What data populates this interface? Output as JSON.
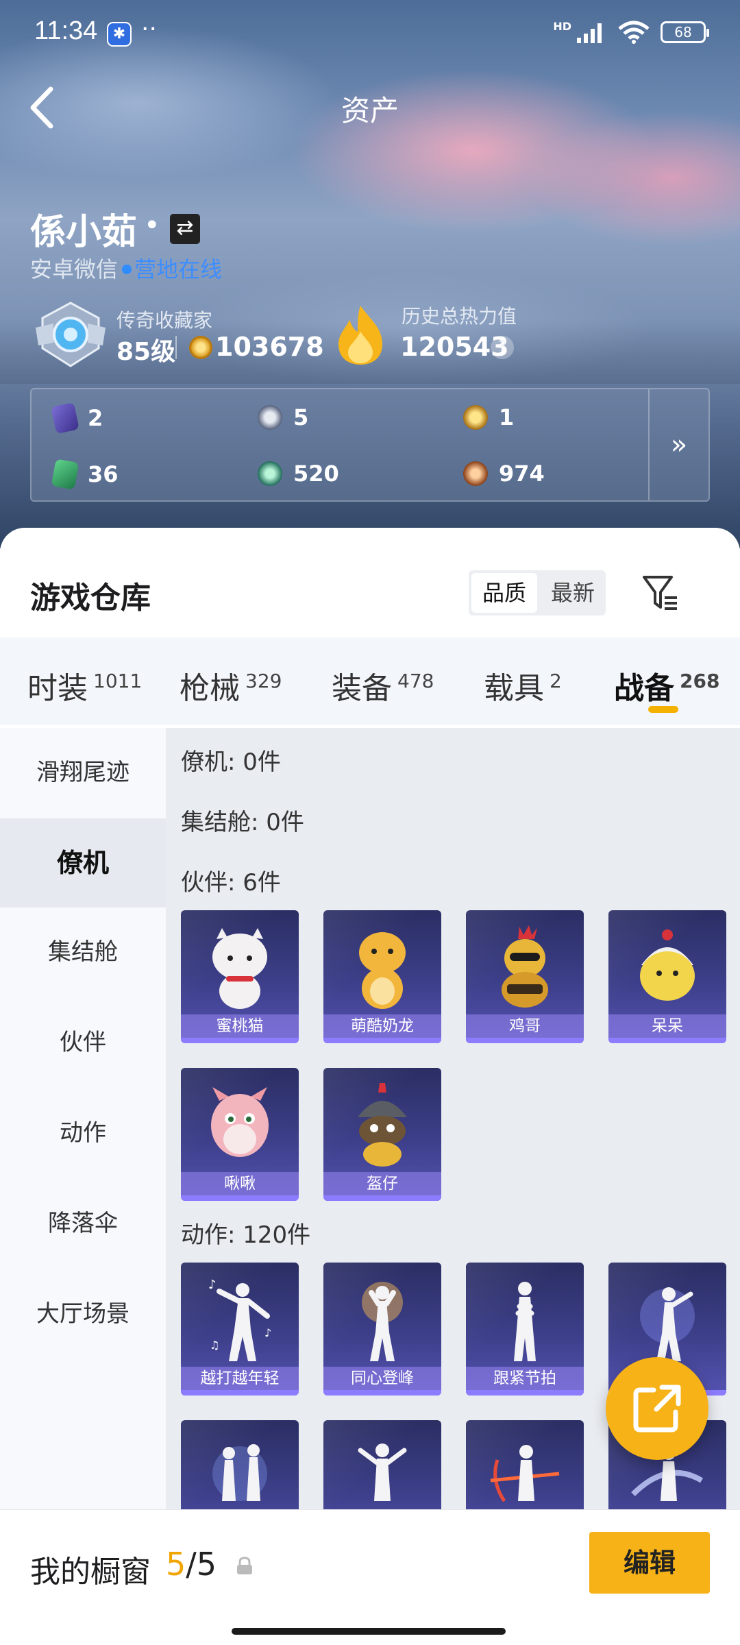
{
  "status_bar": {
    "time": "11:34",
    "battery": "68",
    "network": "HD"
  },
  "header": {
    "title": "资产"
  },
  "user": {
    "name": "係小茹",
    "platform": "安卓微信",
    "online_status": "营地在线",
    "collector_title": "传奇收藏家",
    "level": "85级",
    "coins": "103678",
    "heat_label": "历史总热力值",
    "heat_value": "120543",
    "help": "?"
  },
  "resources": [
    {
      "icon": "purple-card-icon",
      "value": "2"
    },
    {
      "icon": "silver-coin-icon",
      "value": "5"
    },
    {
      "icon": "gold-badge-icon",
      "value": "1"
    },
    {
      "icon": "green-card-icon",
      "value": "36"
    },
    {
      "icon": "green-orb-icon",
      "value": "520"
    },
    {
      "icon": "bronze-coin-icon",
      "value": "974"
    }
  ],
  "resources_more": "»",
  "warehouse": {
    "title": "游戏仓库",
    "sort_quality": "品质",
    "sort_newest": "最新"
  },
  "tabs": [
    {
      "label": "时装",
      "count": "1011"
    },
    {
      "label": "枪械",
      "count": "329"
    },
    {
      "label": "装备",
      "count": "478"
    },
    {
      "label": "载具",
      "count": "2"
    },
    {
      "label": "战备",
      "count": "268"
    }
  ],
  "sidebar": [
    "滑翔尾迹",
    "僚机",
    "集结舱",
    "伙伴",
    "动作",
    "降落伞",
    "大厅场景"
  ],
  "sections": {
    "wingman": "僚机: 0件",
    "pod": "集结舱: 0件",
    "partner": "伙伴: 6件",
    "action": "动作: 120件"
  },
  "partners": [
    "蜜桃猫",
    "萌酷奶龙",
    "鸡哥",
    "呆呆",
    "啾啾",
    "盔仔"
  ],
  "actions": [
    "越打越年轻",
    "同心登峰",
    "跟紧节拍"
  ],
  "bottom": {
    "title": "我的橱窗",
    "current": "5",
    "separator": "/",
    "total": "5",
    "edit": "编辑"
  },
  "colors": {
    "accent": "#f6b217",
    "online": "#3c8dff",
    "card_bg": "#3d3f8a"
  }
}
